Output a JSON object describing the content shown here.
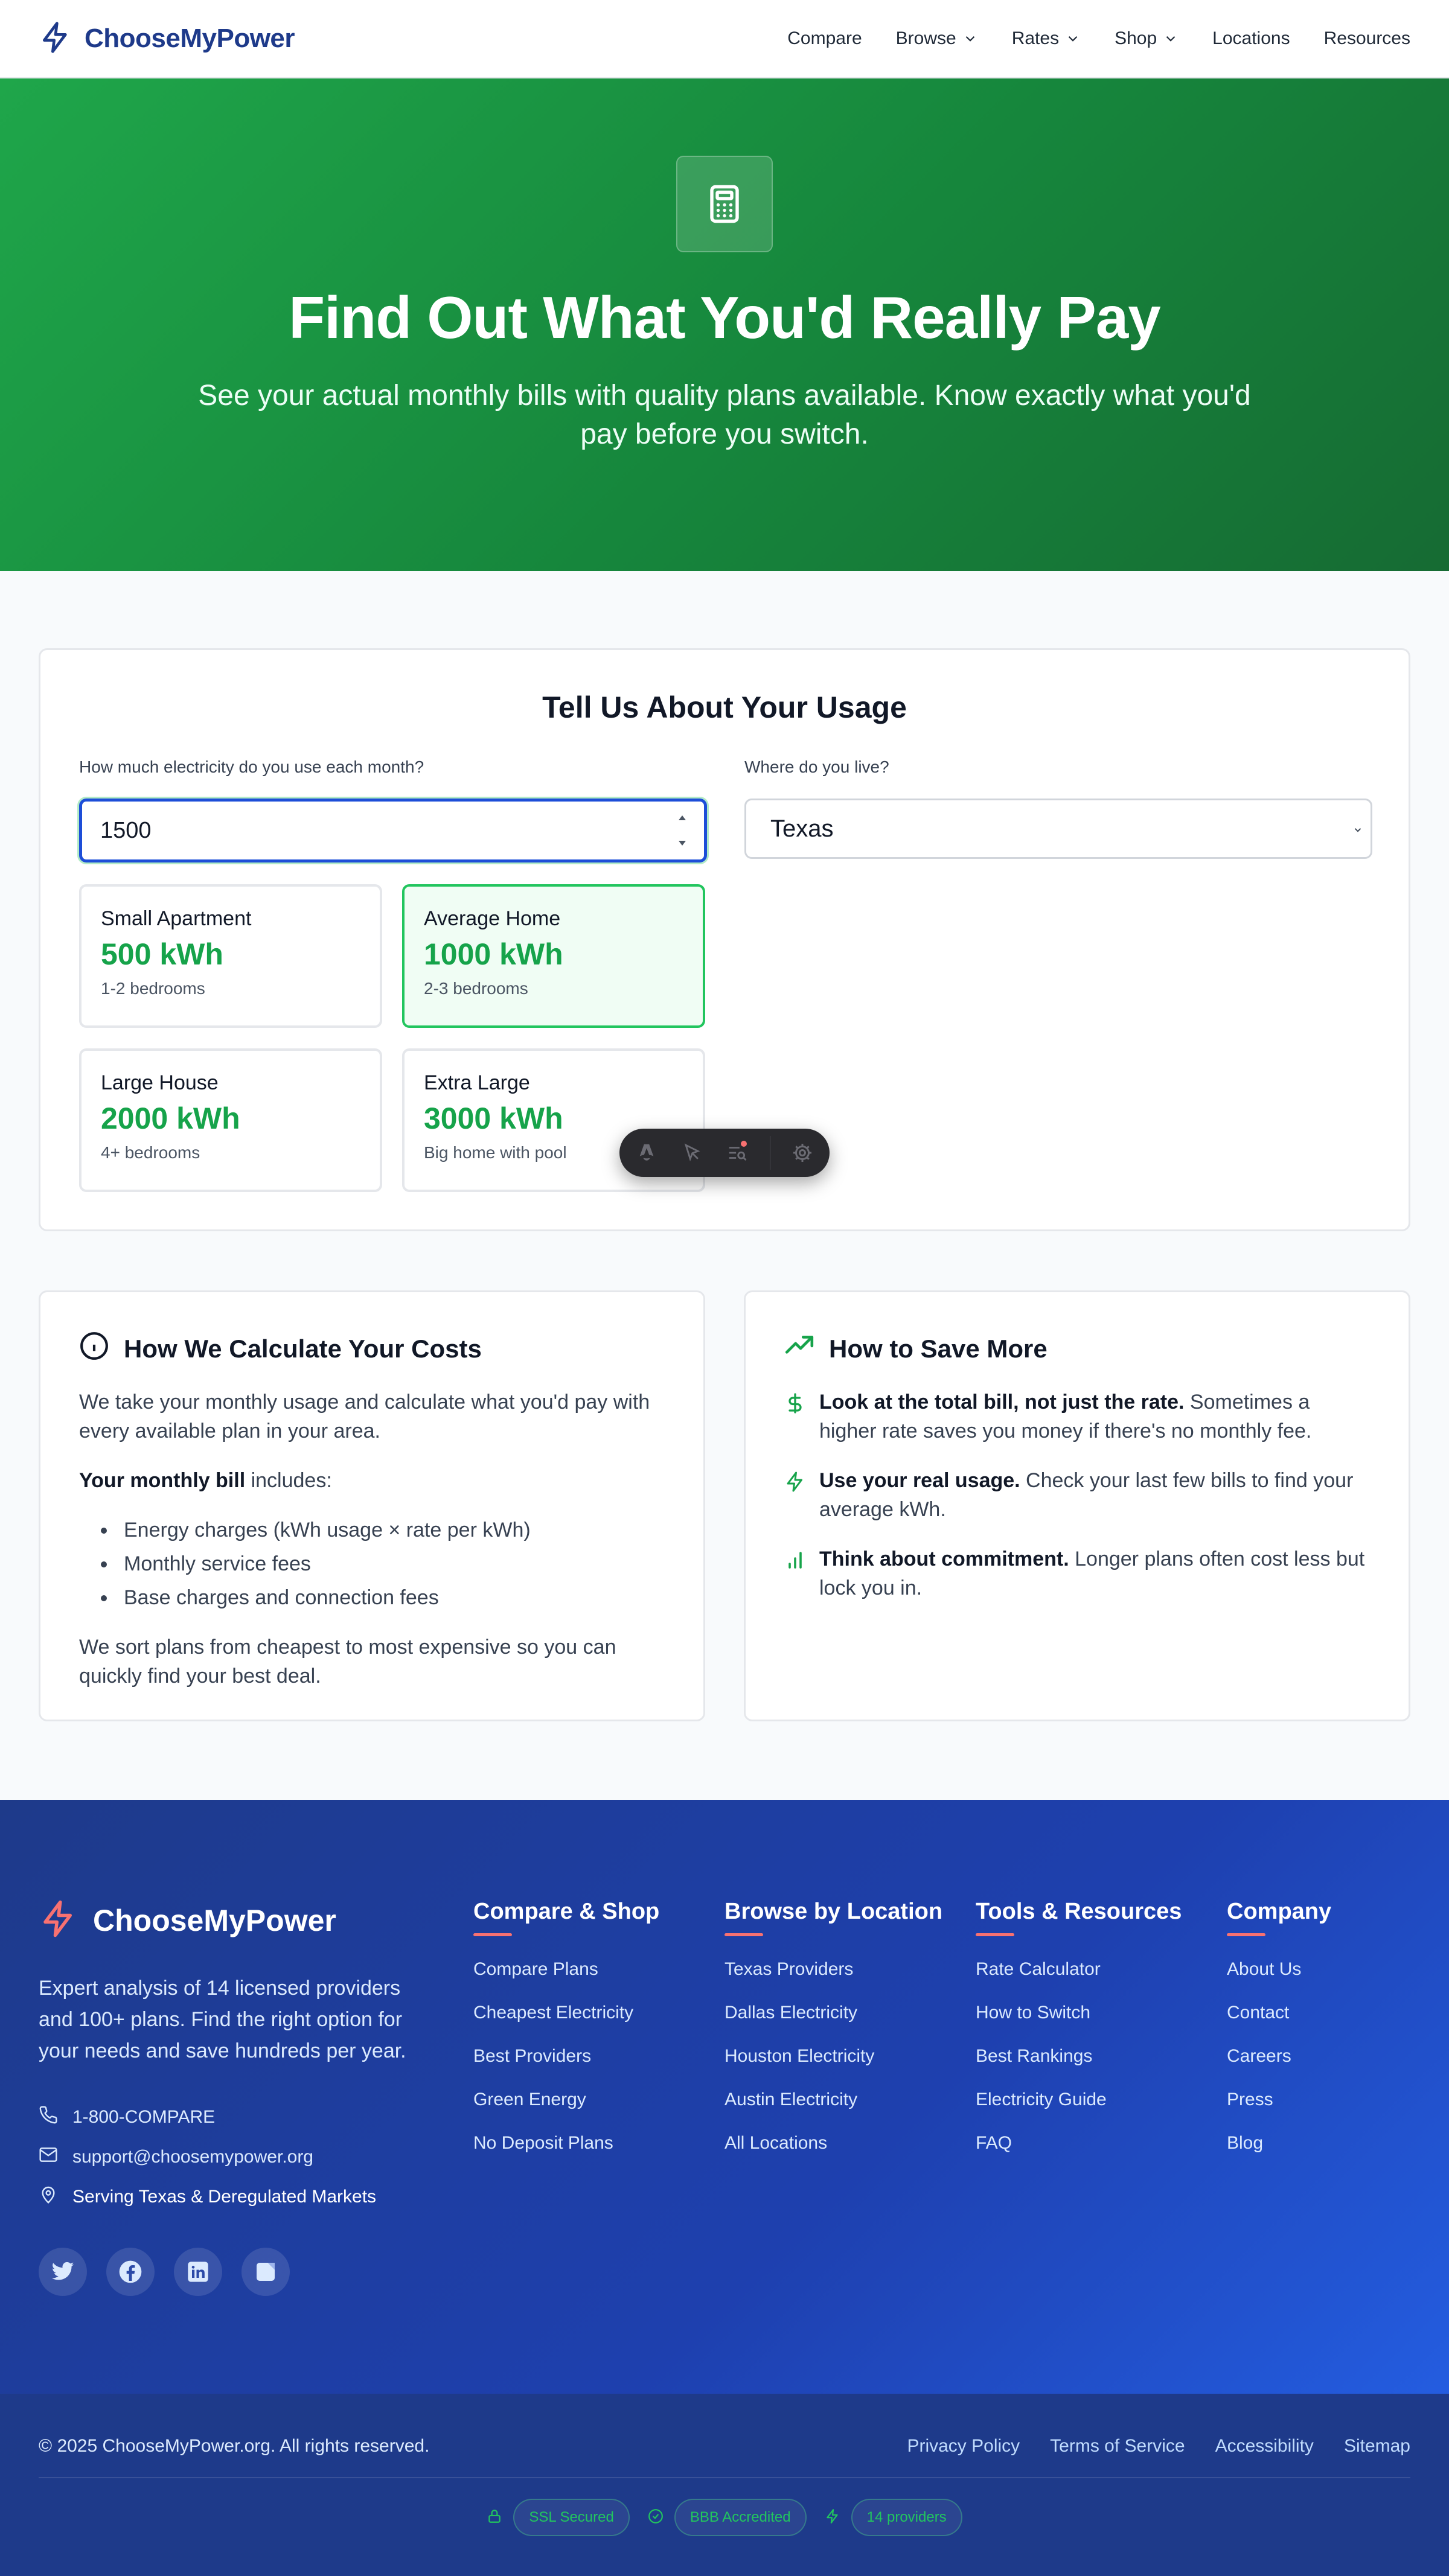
{
  "nav": {
    "brand": "ChooseMyPower",
    "links": [
      {
        "label": "Compare",
        "dropdown": false
      },
      {
        "label": "Browse",
        "dropdown": true
      },
      {
        "label": "Rates",
        "dropdown": true
      },
      {
        "label": "Shop",
        "dropdown": true
      },
      {
        "label": "Locations",
        "dropdown": false
      },
      {
        "label": "Resources",
        "dropdown": false
      }
    ]
  },
  "hero": {
    "icon": "calculator-icon",
    "title": "Find Out What You'd Really Pay",
    "subtitle": "See your actual monthly bills with quality plans available. Know exactly what you'd pay before you switch."
  },
  "usage": {
    "title": "Tell Us About Your Usage",
    "usage_label": "How much electricity do you use each month?",
    "usage_value": "1500",
    "location_label": "Where do you live?",
    "location_value": "Texas",
    "presets": [
      {
        "name": "Small Apartment",
        "kwh": "500 kWh",
        "desc": "1-2 bedrooms",
        "selected": false
      },
      {
        "name": "Average Home",
        "kwh": "1000 kWh",
        "desc": "2-3 bedrooms",
        "selected": true
      },
      {
        "name": "Large House",
        "kwh": "2000 kWh",
        "desc": "4+ bedrooms",
        "selected": false
      },
      {
        "name": "Extra Large",
        "kwh": "3000 kWh",
        "desc": "Big home with pool",
        "selected": false
      }
    ]
  },
  "calc": {
    "title": "How We Calculate Your Costs",
    "intro": "We take your monthly usage and calculate what you'd pay with every available plan in your area.",
    "bill_bold": "Your monthly bill",
    "bill_rest": " includes:",
    "items": [
      "Energy charges (kWh usage × rate per kWh)",
      "Monthly service fees",
      "Base charges and connection fees"
    ],
    "outro": "We sort plans from cheapest to most expensive so you can quickly find your best deal."
  },
  "save": {
    "title": "How to Save More",
    "tips": [
      {
        "icon": "dollar-icon",
        "bold": "Look at the total bill, not just the rate.",
        "text": " Sometimes a higher rate saves you money if there's no monthly fee."
      },
      {
        "icon": "lightning-icon",
        "bold": "Use your real usage.",
        "text": " Check your last few bills to find your average kWh."
      },
      {
        "icon": "bar-chart-icon",
        "bold": "Think about commitment.",
        "text": " Longer plans often cost less but lock you in."
      }
    ]
  },
  "footer": {
    "brand": "ChooseMyPower",
    "desc": "Expert analysis of 14 licensed providers and 100+ plans. Find the right option for your needs and save hundreds per year.",
    "phone": "1-800-COMPARE",
    "email": "support@choosemypower.org",
    "service": "Serving Texas & Deregulated Markets",
    "columns": [
      {
        "title": "Compare & Shop",
        "items": [
          "Compare Plans",
          "Cheapest Electricity",
          "Best Providers",
          "Green Energy",
          "No Deposit Plans"
        ]
      },
      {
        "title": "Browse by Location",
        "items": [
          "Texas Providers",
          "Dallas Electricity",
          "Houston Electricity",
          "Austin Electricity",
          "All Locations"
        ]
      },
      {
        "title": "Tools & Resources",
        "items": [
          "Rate Calculator",
          "How to Switch",
          "Best Rankings",
          "Electricity Guide",
          "FAQ"
        ]
      },
      {
        "title": "Company",
        "items": [
          "About Us",
          "Contact",
          "Careers",
          "Press",
          "Blog"
        ]
      }
    ],
    "copyright": "© 2025 ChooseMyPower.org. All rights reserved.",
    "legal": [
      "Privacy Policy",
      "Terms of Service",
      "Accessibility",
      "Sitemap"
    ],
    "badges": [
      {
        "icon": "lock-icon",
        "label": "SSL Secured"
      },
      {
        "icon": "check-circle-icon",
        "label": "BBB Accredited"
      },
      {
        "icon": "lightning-icon",
        "label": "14 providers"
      }
    ]
  },
  "colors": {
    "brand_blue": "#1e3a8a",
    "hero_green": "#16a34a",
    "accent_green": "#22c55e",
    "accent_red": "#f87171"
  }
}
